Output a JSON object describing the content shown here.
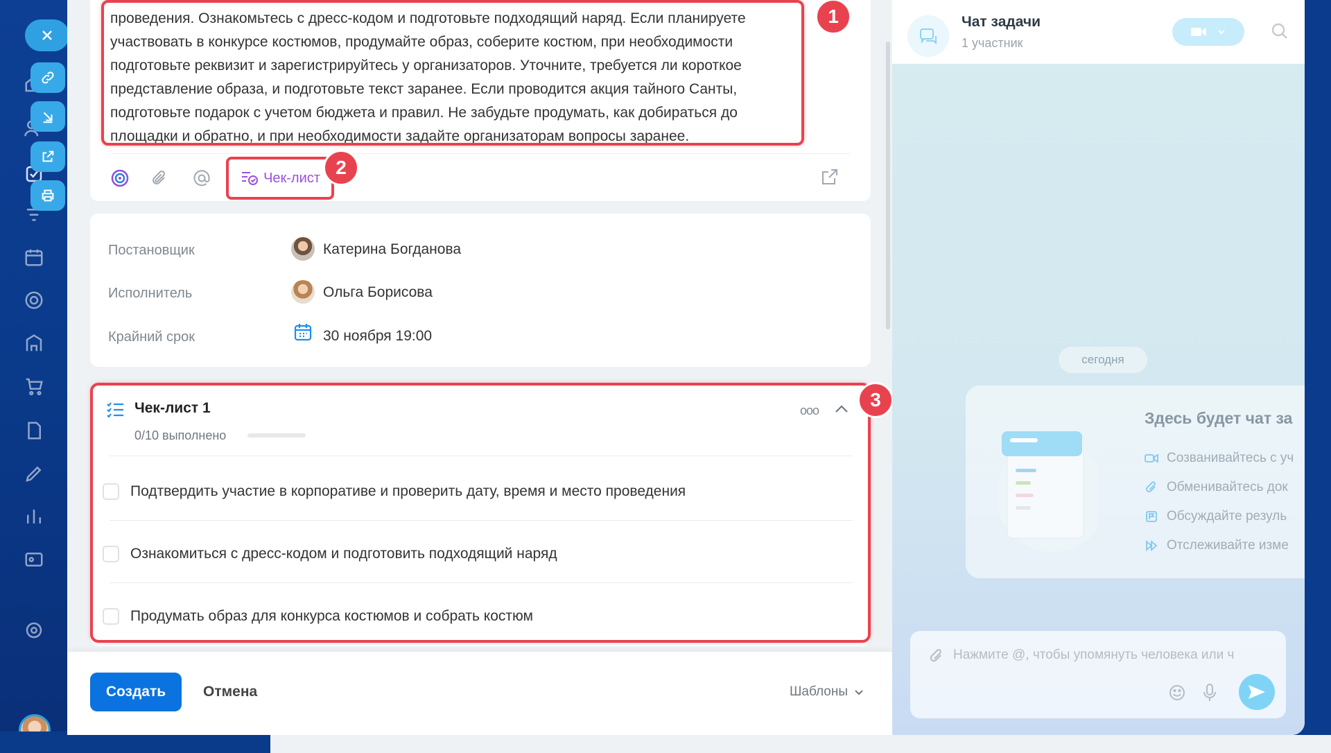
{
  "description": {
    "text": "проведения. Ознакомьтесь с дресс-кодом и подготовьте подходящий наряд. Если планируете участвовать в конкурсе костюмов, продумайте образ, соберите костюм, при необходимости подготовьте реквизит и зарегистрируйтесь у организаторов. Уточните, требуется ли короткое представление образа, и подготовьте текст заранее. Если проводится акция тайного Санты, подготовьте подарок с учетом бюджета и правил. Не забудьте продумать, как добираться до площадки и обратно, и при необходимости задайте организаторам вопросы заранее."
  },
  "toolbar": {
    "checklist_label": "Чек-лист"
  },
  "people": {
    "creator_label": "Постановщик",
    "creator_name": "Катерина Богданова",
    "assignee_label": "Исполнитель",
    "assignee_name": "Ольга Борисова",
    "deadline_label": "Крайний срок",
    "deadline_value": "30 ноября 19:00"
  },
  "checklist": {
    "title": "Чек-лист 1",
    "progress_text": "0/10 выполнено",
    "progress_fraction": 0,
    "items": [
      {
        "label": "Подтвердить участие в корпоративе и проверить дату, время и место проведения",
        "checked": false
      },
      {
        "label": "Ознакомиться с дресс-кодом и подготовить подходящий наряд",
        "checked": false
      },
      {
        "label": "Продумать образ для конкурса костюмов и собрать костюм",
        "checked": false
      }
    ]
  },
  "footer": {
    "create_label": "Создать",
    "cancel_label": "Отмена",
    "templates_label": "Шаблоны"
  },
  "badges": [
    "1",
    "2",
    "3"
  ],
  "chat": {
    "title": "Чат задачи",
    "subtitle": "1 участник",
    "today_label": "сегодня",
    "empty_title": "Здесь будет чат за",
    "features": [
      "Созванивайтесь с уч",
      "Обменивайтесь док",
      "Обсуждайте резуль",
      "Отслеживайте изме"
    ],
    "input_placeholder": "Нажмите @, чтобы упомянуть человека или ч"
  },
  "colors": {
    "accent": "#0a73e0",
    "highlight": "#e9424f",
    "checklist_purple": "#9b4fe0"
  }
}
